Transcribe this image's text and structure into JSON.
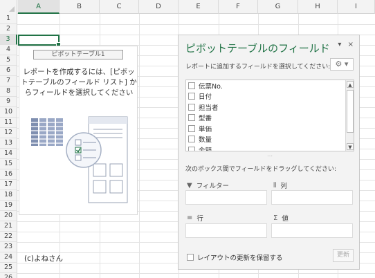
{
  "spreadsheet": {
    "columns": [
      "A",
      "B",
      "C",
      "D",
      "E",
      "F",
      "G",
      "H",
      "I"
    ],
    "rows": [
      "1",
      "2",
      "3",
      "4",
      "5",
      "6",
      "7",
      "8",
      "9",
      "10",
      "11",
      "12",
      "13",
      "14",
      "15",
      "16",
      "17",
      "18",
      "19",
      "20",
      "21",
      "22",
      "23",
      "24",
      "25",
      "26"
    ],
    "selected_column": "A",
    "selected_row": "3"
  },
  "pivot_placeholder": {
    "name": "ピボットテーブル1",
    "message_line1": "レポートを作成するには、[ピボッ",
    "message_line2": "トテーブルのフィールド リスト] か",
    "message_line3": "らフィールドを選択してください"
  },
  "credit": "(c)よねさん",
  "field_pane": {
    "title": "ピボットテーブルのフィールド",
    "dropdown_icon": "▾",
    "close_icon": "×",
    "subtitle": "レポートに追加するフィールドを選択してください:",
    "gear_label": "⚙ ▾",
    "fields": [
      "伝票No.",
      "日付",
      "担当者",
      "型番",
      "単価",
      "数量",
      "金額"
    ],
    "drag_label": "次のボックス間でフィールドをドラッグしてください:",
    "areas": {
      "filter": {
        "icon": "▼",
        "label": "フィルター"
      },
      "columns": {
        "icon": "⦀",
        "label": "列"
      },
      "rows": {
        "icon": "≡",
        "label": "行"
      },
      "values": {
        "icon": "Σ",
        "label": "値"
      }
    },
    "defer_label": "レイアウトの更新を保留する",
    "update_label": "更新"
  },
  "colors": {
    "accent": "#217346"
  }
}
